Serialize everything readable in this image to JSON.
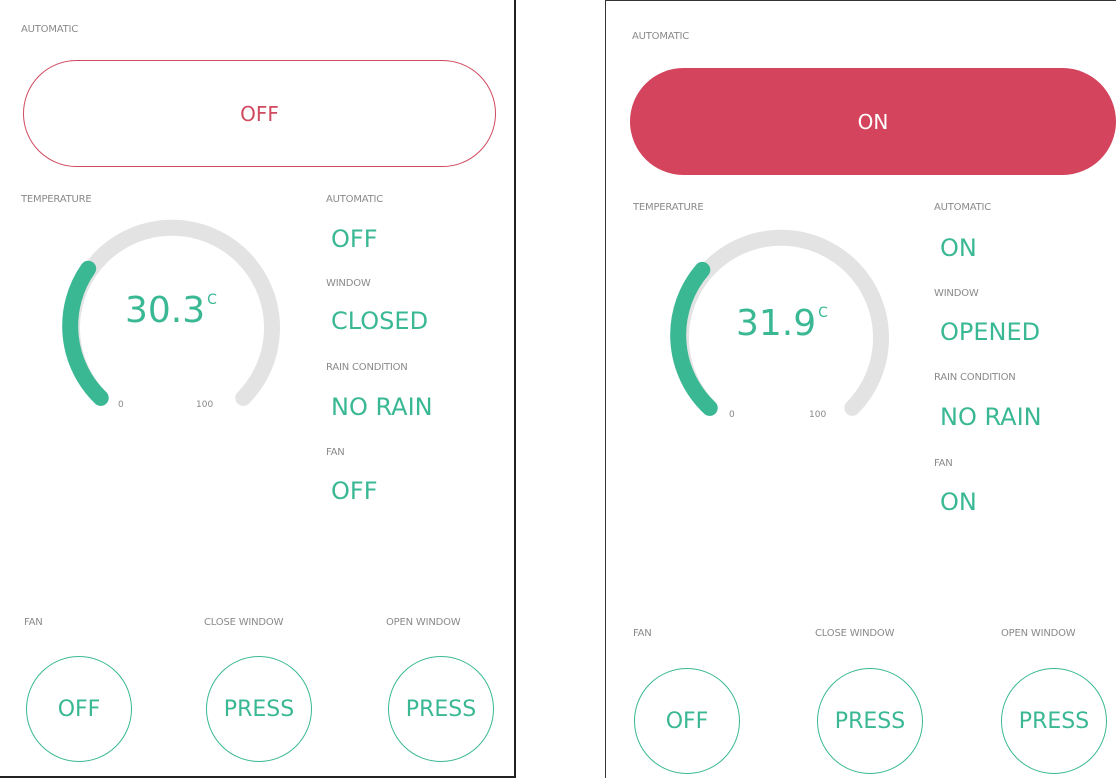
{
  "colors": {
    "accent": "#3ab894",
    "toggle": "#d4445d",
    "gauge_track": "#e3e3e3",
    "label": "#8a8a8a"
  },
  "left": {
    "automatic_label": "AUTOMATIC",
    "automatic_toggle": "OFF",
    "temperature_label": "TEMPERATURE",
    "gauge": {
      "value": "30.3",
      "unit": "C",
      "min": "0",
      "max": "100"
    },
    "status": [
      {
        "label": "AUTOMATIC",
        "value": "OFF"
      },
      {
        "label": "WINDOW",
        "value": "CLOSED"
      },
      {
        "label": "RAIN CONDITION",
        "value": "NO RAIN"
      },
      {
        "label": "FAN",
        "value": "OFF"
      }
    ],
    "buttons": [
      {
        "label": "FAN",
        "text": "OFF"
      },
      {
        "label": "CLOSE WINDOW",
        "text": "PRESS"
      },
      {
        "label": "OPEN WINDOW",
        "text": "PRESS"
      }
    ]
  },
  "right": {
    "automatic_label": "AUTOMATIC",
    "automatic_toggle": "ON",
    "temperature_label": "TEMPERATURE",
    "gauge": {
      "value": "31.9",
      "unit": "C",
      "min": "0",
      "max": "100"
    },
    "status": [
      {
        "label": "AUTOMATIC",
        "value": "ON"
      },
      {
        "label": "WINDOW",
        "value": "OPENED"
      },
      {
        "label": "RAIN CONDITION",
        "value": "NO RAIN"
      },
      {
        "label": "FAN",
        "value": "ON"
      }
    ],
    "buttons": [
      {
        "label": "FAN",
        "text": "OFF"
      },
      {
        "label": "CLOSE WINDOW",
        "text": "PRESS"
      },
      {
        "label": "OPEN WINDOW",
        "text": "PRESS"
      }
    ]
  }
}
